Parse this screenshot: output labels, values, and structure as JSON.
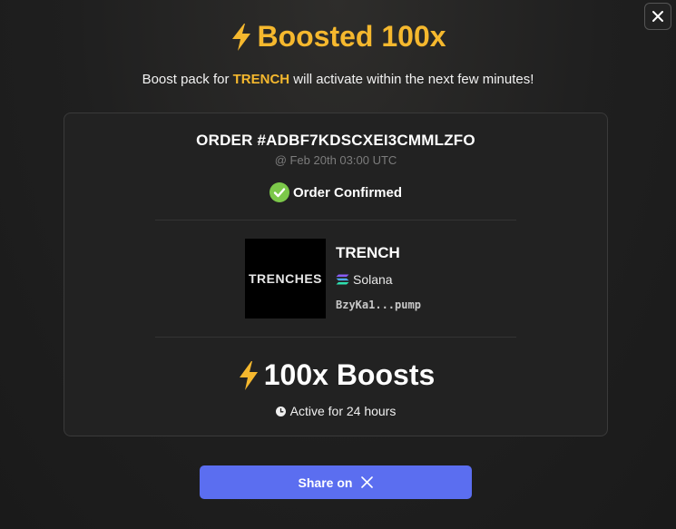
{
  "header": {
    "title": "Boosted 100x",
    "subtitle_prefix": "Boost pack for",
    "subtitle_token": "TRENCH",
    "subtitle_suffix": "will activate within the next few minutes!"
  },
  "order": {
    "id_label": "ORDER #ADBF7KDSCXEI3CMMLZFO",
    "date": "@ Feb 20th 03:00 UTC",
    "status": "Order Confirmed"
  },
  "token": {
    "image_text": "TRENCHES",
    "name": "TRENCH",
    "chain": "Solana",
    "address": "BzyKa1...pump"
  },
  "boost": {
    "amount": "100x Boosts",
    "duration": "Active for 24 hours"
  },
  "share": {
    "label": "Share on"
  },
  "colors": {
    "accent": "#f5b82e",
    "success": "#7cc84a",
    "button": "#5b6ef0"
  },
  "icons": [
    "close-icon",
    "lightning-icon",
    "check-circle-icon",
    "solana-icon",
    "clock-icon",
    "x-logo-icon"
  ]
}
